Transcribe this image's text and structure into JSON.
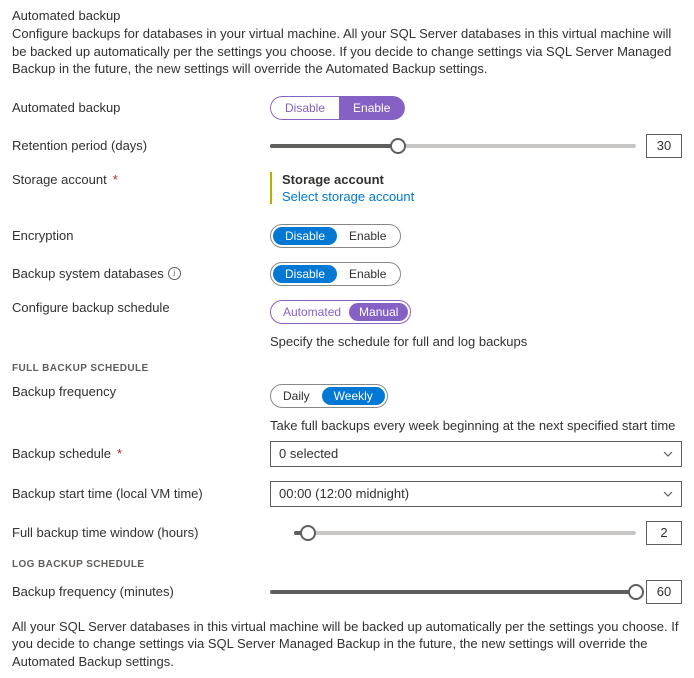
{
  "header": {
    "title": "Automated backup",
    "description": "Configure backups for databases in your virtual machine. All your SQL Server databases in this virtual machine will be backed up automatically per the settings you choose. If you decide to change settings via SQL Server Managed Backup in the future, the new settings will override the Automated Backup settings."
  },
  "fields": {
    "automated_backup": {
      "label": "Automated backup",
      "disable": "Disable",
      "enable": "Enable"
    },
    "retention": {
      "label": "Retention period (days)",
      "value": "30",
      "percent": 35
    },
    "storage": {
      "label": "Storage account",
      "block_title": "Storage account",
      "link": "Select storage account"
    },
    "encryption": {
      "label": "Encryption",
      "disable": "Disable",
      "enable": "Enable"
    },
    "sysdb": {
      "label": "Backup system databases",
      "disable": "Disable",
      "enable": "Enable"
    },
    "schedule": {
      "label": "Configure backup schedule",
      "automated": "Automated",
      "manual": "Manual",
      "helper": "Specify the schedule for full and log backups"
    }
  },
  "full_schedule": {
    "header": "FULL BACKUP SCHEDULE",
    "frequency": {
      "label": "Backup frequency",
      "daily": "Daily",
      "weekly": "Weekly",
      "helper": "Take full backups every week beginning at the next specified start time"
    },
    "schedule": {
      "label": "Backup schedule",
      "value": "0 selected"
    },
    "start": {
      "label": "Backup start time (local VM time)",
      "value": "00:00 (12:00 midnight)"
    },
    "window": {
      "label": "Full backup time window (hours)",
      "value": "2",
      "percent": 4
    }
  },
  "log_schedule": {
    "header": "LOG BACKUP SCHEDULE",
    "frequency": {
      "label": "Backup frequency (minutes)",
      "value": "60",
      "percent": 100
    }
  },
  "footer": "All your SQL Server databases in this virtual machine will be backed up automatically per the settings you choose. If you decide to change settings via SQL Server Managed Backup in the future, the new settings will override the Automated Backup settings."
}
